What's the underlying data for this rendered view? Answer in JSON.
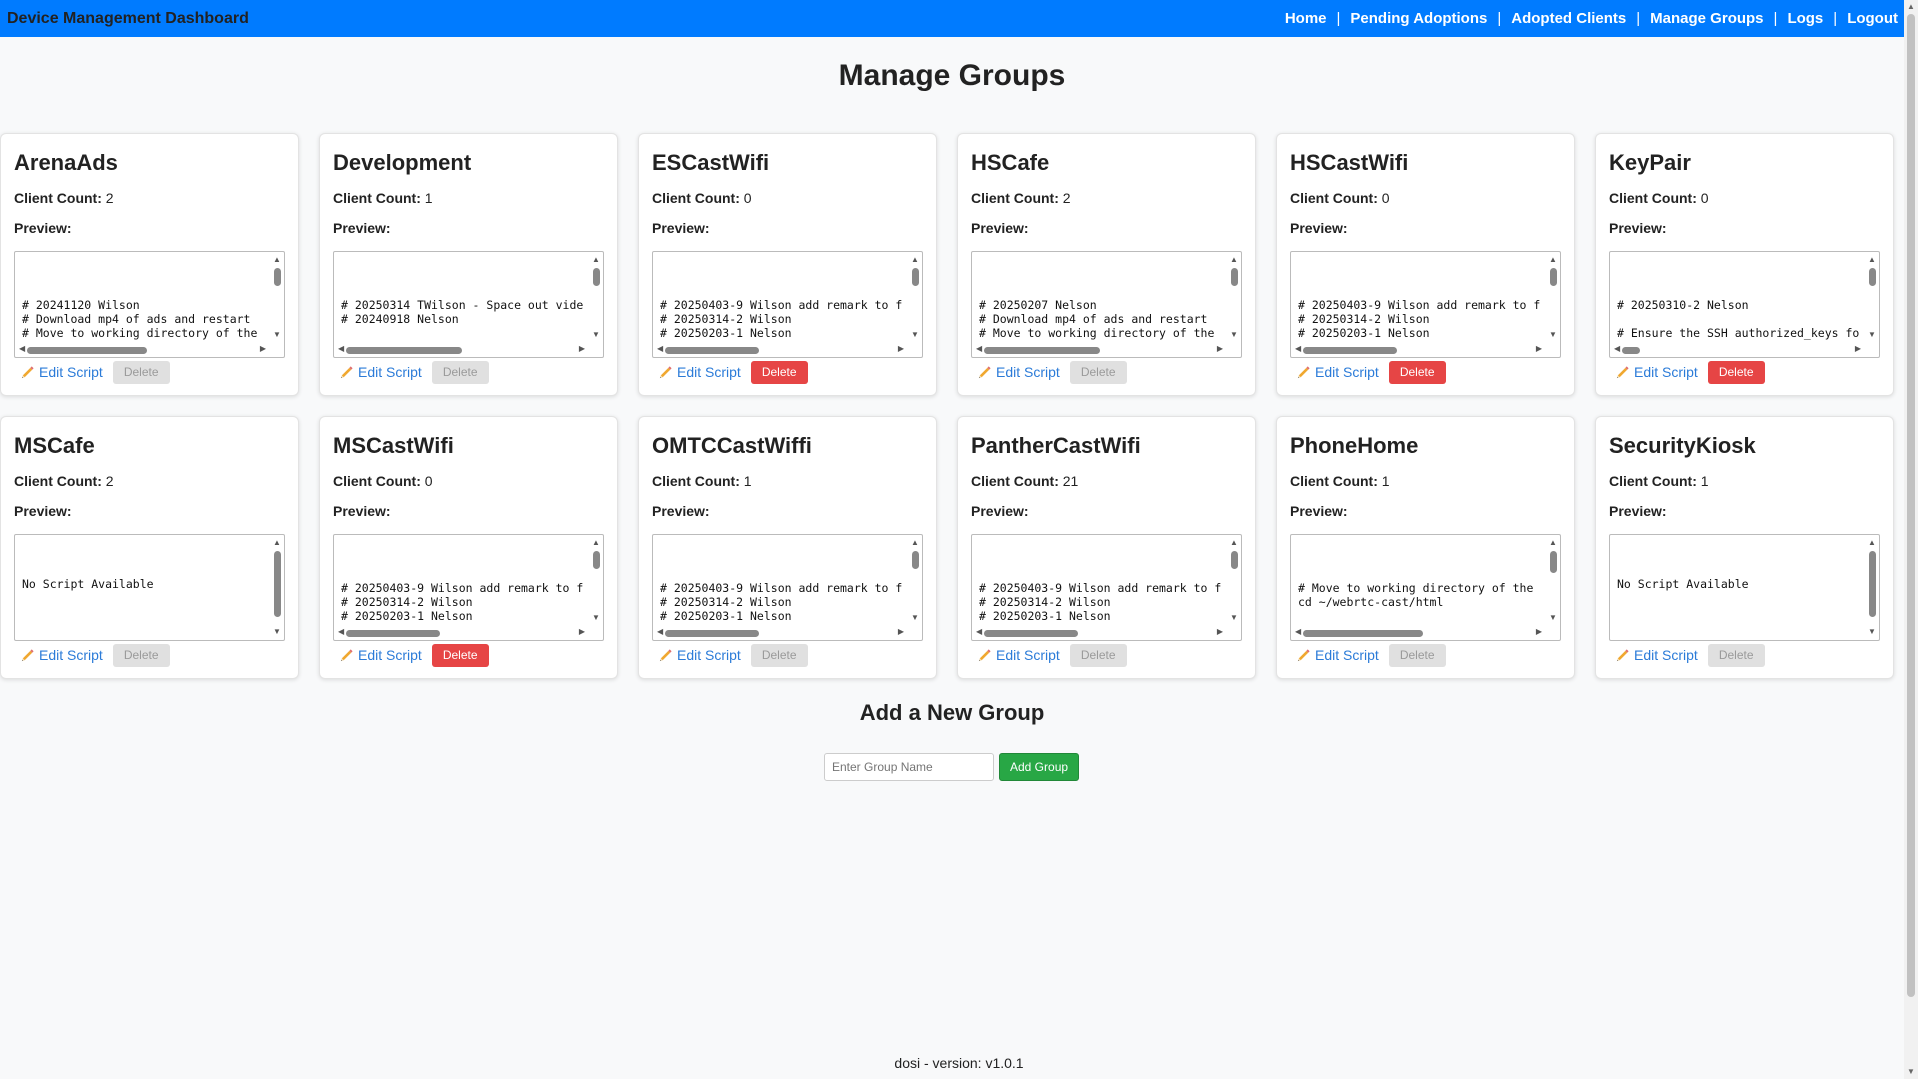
{
  "header": {
    "title": "Device Management Dashboard",
    "nav": [
      "Home",
      "Pending Adoptions",
      "Adopted Clients",
      "Manage Groups",
      "Logs",
      "Logout"
    ],
    "nav_separator": "|"
  },
  "page": {
    "title": "Manage Groups"
  },
  "labels": {
    "client_count": "Client Count:",
    "preview": "Preview:",
    "edit_script": "Edit Script",
    "delete": "Delete"
  },
  "groups": [
    {
      "name": "ArenaAds",
      "client_count": "2",
      "preview": "# 20241120 Wilson\n# Download mp4 of ads and restart\n# Move to working directory of the",
      "delete_enabled": false
    },
    {
      "name": "Development",
      "client_count": "1",
      "preview": "# 20250314 TWilson - Space out vide\n# 20240918 Nelson",
      "delete_enabled": false
    },
    {
      "name": "ESCastWifi",
      "client_count": "0",
      "preview": "# 20250403-9 Wilson add remark to f\n# 20250314-2 Wilson\n# 20250203-1 Nelson",
      "delete_enabled": true
    },
    {
      "name": "HSCafe",
      "client_count": "2",
      "preview": "# 20250207 Nelson\n# Download mp4 of ads and restart\n# Move to working directory of the",
      "delete_enabled": false
    },
    {
      "name": "HSCastWifi",
      "client_count": "0",
      "preview": "# 20250403-9 Wilson add remark to f\n# 20250314-2 Wilson\n# 20250203-1 Nelson",
      "delete_enabled": true
    },
    {
      "name": "KeyPair",
      "client_count": "0",
      "preview": "# 20250310-2 Nelson\n\n# Ensure the SSH authorized_keys fo",
      "delete_enabled": true
    },
    {
      "name": "MSCafe",
      "client_count": "2",
      "preview": "No Script Available",
      "delete_enabled": false
    },
    {
      "name": "MSCastWifi",
      "client_count": "0",
      "preview": "# 20250403-9 Wilson add remark to f\n# 20250314-2 Wilson\n# 20250203-1 Nelson",
      "delete_enabled": true
    },
    {
      "name": "OMTCCastWiffi",
      "client_count": "1",
      "preview": "# 20250403-9 Wilson add remark to f\n# 20250314-2 Wilson\n# 20250203-1 Nelson",
      "delete_enabled": false
    },
    {
      "name": "PantherCastWifi",
      "client_count": "21",
      "preview": "# 20250403-9 Wilson add remark to f\n# 20250314-2 Wilson\n# 20250203-1 Nelson",
      "delete_enabled": false
    },
    {
      "name": "PhoneHome",
      "client_count": "1",
      "preview": "# Move to working directory of the\ncd ~/webrtc-cast/html",
      "delete_enabled": false
    },
    {
      "name": "SecurityKiosk",
      "client_count": "1",
      "preview": "No Script Available",
      "delete_enabled": false
    }
  ],
  "add_group": {
    "title": "Add a New Group",
    "placeholder": "Enter Group Name",
    "button": "Add Group"
  },
  "footer": {
    "text": "dosi - version: v1.0.1"
  },
  "colors": {
    "navbar": "#007bff",
    "delete_active": "#e64545",
    "add_button": "#28a745",
    "link": "#2b7bd8"
  }
}
